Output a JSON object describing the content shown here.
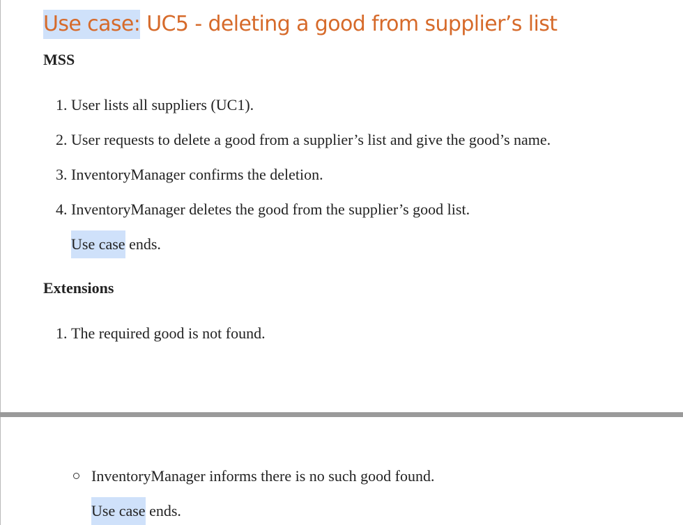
{
  "title": {
    "prefix": "Use case:",
    "rest": " UC5 - deleting a good from supplier’s list"
  },
  "mss": {
    "heading": "MSS",
    "steps": [
      {
        "num": "1.",
        "text": "User lists all suppliers (UC1)."
      },
      {
        "num": "2.",
        "text": "User requests to delete a good from a supplier’s list and give the good’s name."
      },
      {
        "num": "3.",
        "text": "InventoryManager confirms the deletion."
      },
      {
        "num": "4.",
        "text": "InventoryManager deletes the good from the supplier’s good list."
      }
    ],
    "end": {
      "highlight": "Use case",
      "rest": " ends."
    }
  },
  "extensions": {
    "heading": "Extensions",
    "items": [
      {
        "num": "1.",
        "text": "The required good is not found."
      }
    ],
    "sub_items": [
      {
        "text": "InventoryManager informs there is no such good found."
      }
    ],
    "end": {
      "highlight": "Use case",
      "rest": " ends."
    }
  },
  "colors": {
    "title": "#d66a2a",
    "highlight": "#cfe1fa",
    "text": "#222222",
    "page_break": "#9a9a9a"
  }
}
